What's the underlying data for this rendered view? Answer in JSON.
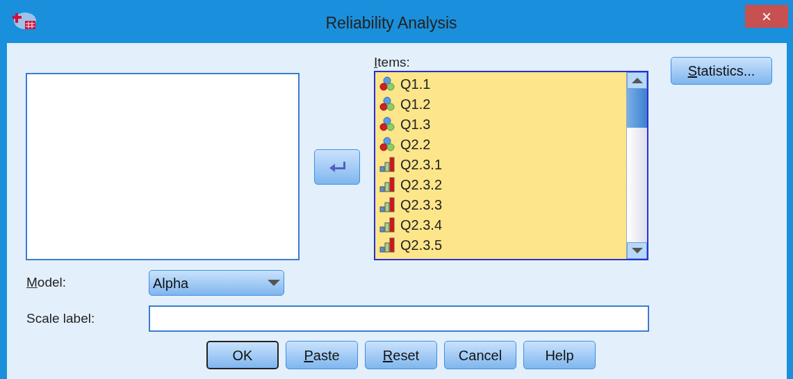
{
  "window": {
    "title": "Reliability Analysis",
    "close": "×"
  },
  "move_button": {
    "kind": "left"
  },
  "items": {
    "label": {
      "access_key": "I",
      "rest": "tems:"
    },
    "list": [
      {
        "name": "Q1.1",
        "kind": "nominal"
      },
      {
        "name": "Q1.2",
        "kind": "nominal"
      },
      {
        "name": "Q1.3",
        "kind": "nominal"
      },
      {
        "name": "Q2.2",
        "kind": "nominal"
      },
      {
        "name": "Q2.3.1",
        "kind": "ordinal"
      },
      {
        "name": "Q2.3.2",
        "kind": "ordinal"
      },
      {
        "name": "Q2.3.3",
        "kind": "ordinal"
      },
      {
        "name": "Q2.3.4",
        "kind": "ordinal"
      },
      {
        "name": "Q2.3.5",
        "kind": "ordinal"
      }
    ]
  },
  "statistics_button": {
    "access_key": "S",
    "rest": "tatistics..."
  },
  "model": {
    "label": {
      "access_key": "M",
      "rest": "odel:"
    },
    "value": "Alpha"
  },
  "scale_label": {
    "label": {
      "rest": "Scale label:"
    }
  },
  "buttons": [
    {
      "rest": "OK",
      "default": true
    },
    {
      "access_key": "P",
      "rest": "aste",
      "default": false
    },
    {
      "access_key": "R",
      "rest": "eset",
      "default": false
    },
    {
      "rest": "Cancel",
      "default": false
    },
    {
      "rest": "Help",
      "default": false
    }
  ]
}
